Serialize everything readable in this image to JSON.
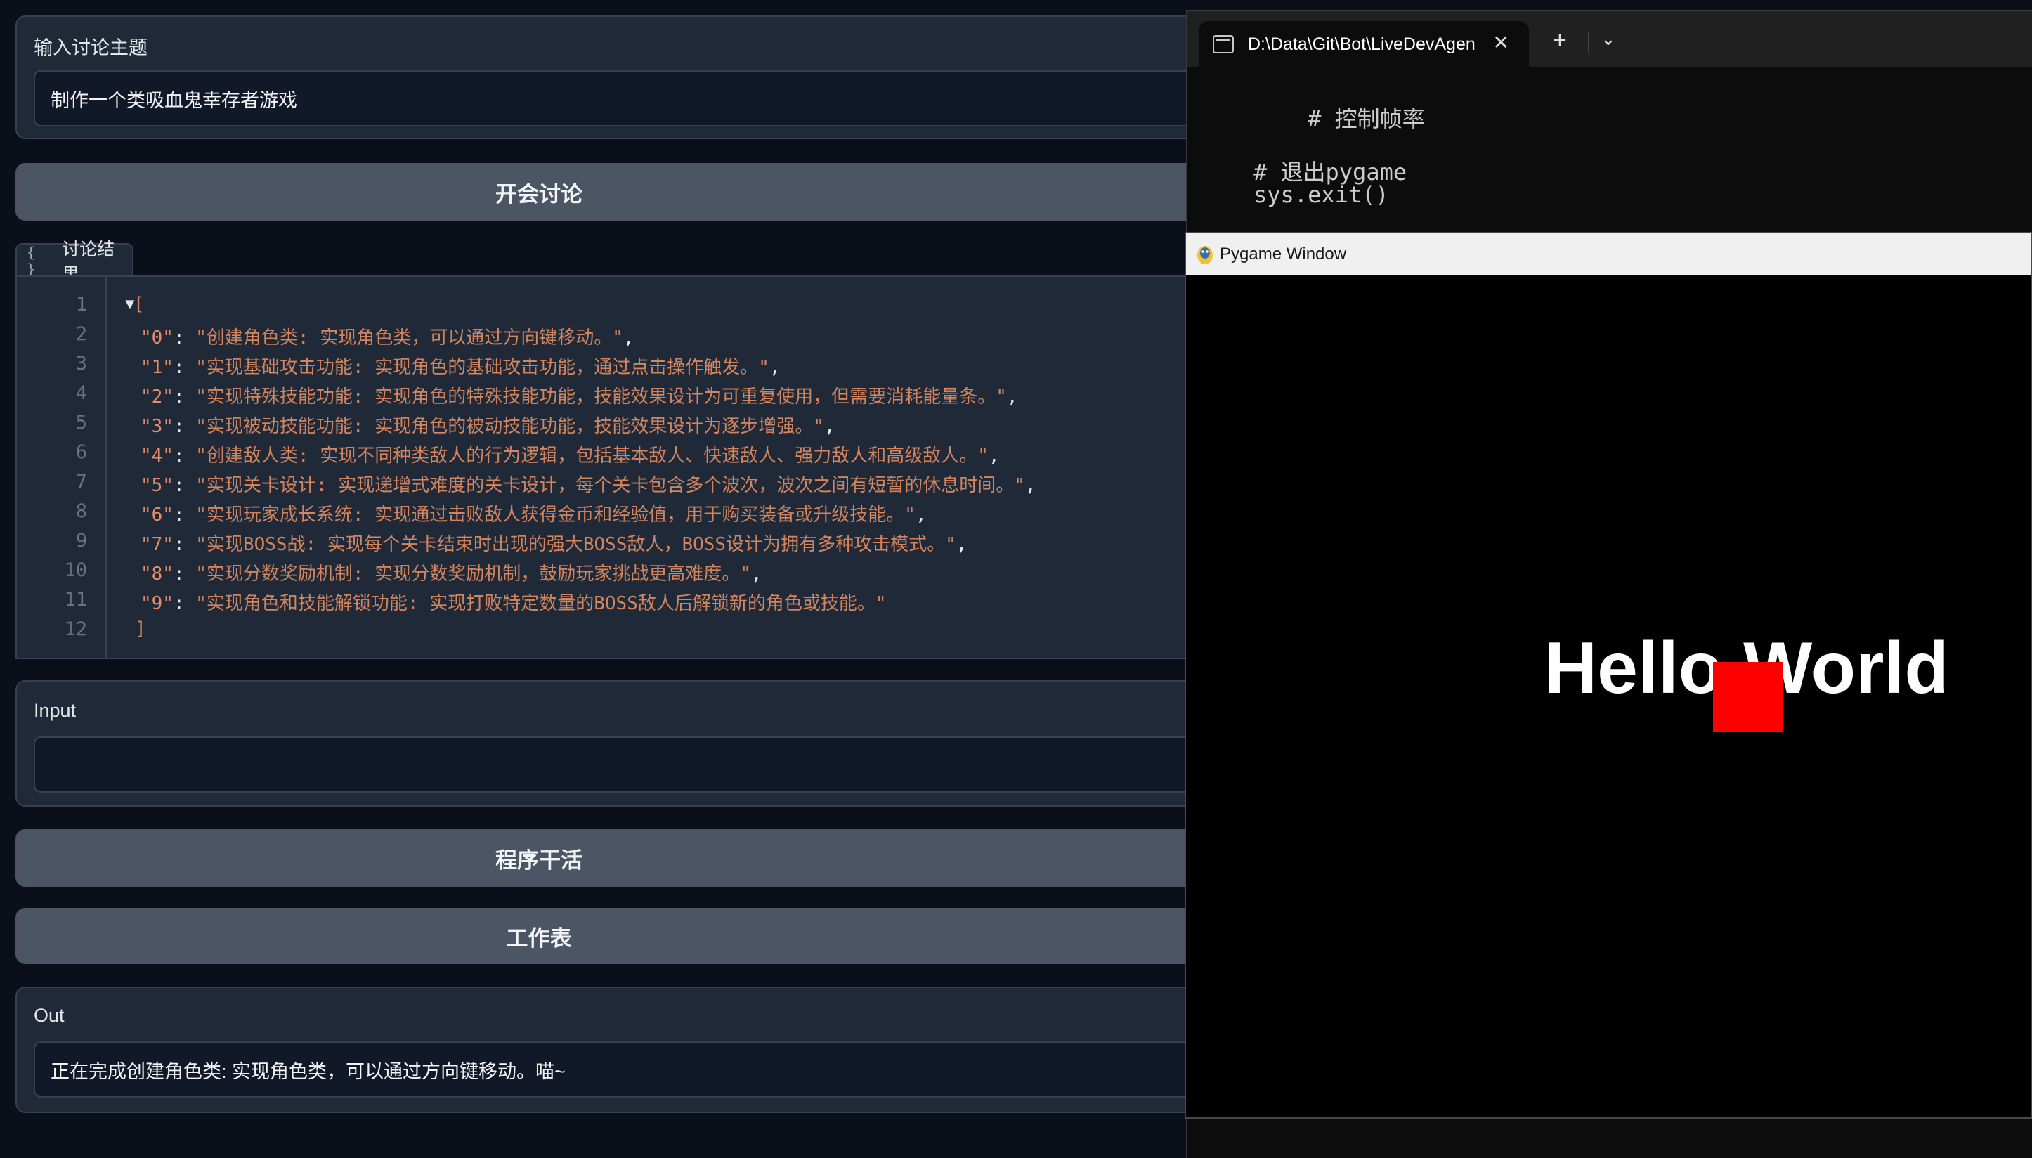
{
  "topic": {
    "label": "输入讨论主题",
    "value": "制作一个类吸血鬼幸存者游戏"
  },
  "buttons": {
    "start_discussion": "开会讨论",
    "program_work": "程序干活",
    "worksheet": "工作表"
  },
  "result": {
    "tab_icon": "{ }",
    "tab_label": "讨论结果",
    "line_numbers": [
      "1",
      "2",
      "3",
      "4",
      "5",
      "6",
      "7",
      "8",
      "9",
      "10",
      "11",
      "12"
    ],
    "open_bracket": "[",
    "close_bracket": "]",
    "items": [
      {
        "key": "\"0\"",
        "value": "\"创建角色类: 实现角色类，可以通过方向键移动。\"",
        "tail": ","
      },
      {
        "key": "\"1\"",
        "value": "\"实现基础攻击功能: 实现角色的基础攻击功能，通过点击操作触发。\"",
        "tail": ","
      },
      {
        "key": "\"2\"",
        "value": "\"实现特殊技能功能: 实现角色的特殊技能功能，技能效果设计为可重复使用，但需要消耗能量条。\"",
        "tail": ","
      },
      {
        "key": "\"3\"",
        "value": "\"实现被动技能功能: 实现角色的被动技能功能，技能效果设计为逐步增强。\"",
        "tail": ","
      },
      {
        "key": "\"4\"",
        "value": "\"创建敌人类: 实现不同种类敌人的行为逻辑，包括基本敌人、快速敌人、强力敌人和高级敌人。\"",
        "tail": ","
      },
      {
        "key": "\"5\"",
        "value": "\"实现关卡设计: 实现递增式难度的关卡设计，每个关卡包含多个波次，波次之间有短暂的休息时间。\"",
        "tail": ","
      },
      {
        "key": "\"6\"",
        "value": "\"实现玩家成长系统: 实现通过击败敌人获得金币和经验值，用于购买装备或升级技能。\"",
        "tail": ","
      },
      {
        "key": "\"7\"",
        "value": "\"实现BOSS战: 实现每个关卡结束时出现的强大BOSS敌人，BOSS设计为拥有多种攻击模式。\"",
        "tail": ","
      },
      {
        "key": "\"8\"",
        "value": "\"实现分数奖励机制: 实现分数奖励机制，鼓励玩家挑战更高难度。\"",
        "tail": ","
      },
      {
        "key": "\"9\"",
        "value": "\"实现角色和技能解锁功能: 实现打败特定数量的BOSS敌人后解锁新的角色或技能。\"",
        "tail": ""
      }
    ]
  },
  "input": {
    "label": "Input",
    "value": ""
  },
  "out": {
    "label": "Out",
    "value": "正在完成创建角色类: 实现角色类，可以通过方向键移动。喵~"
  },
  "terminal": {
    "tab_title": "D:\\Data\\Git\\Bot\\LiveDevAgen",
    "close_glyph": "✕",
    "add_glyph": "+",
    "dropdown_glyph": "⌄",
    "lines": [
      "    # 控制帧率",
      "# 退出pygame",
      "sys.exit()"
    ]
  },
  "pygame": {
    "title": "Pygame Window",
    "text": "Hello World",
    "box_color": "#ff0000"
  }
}
